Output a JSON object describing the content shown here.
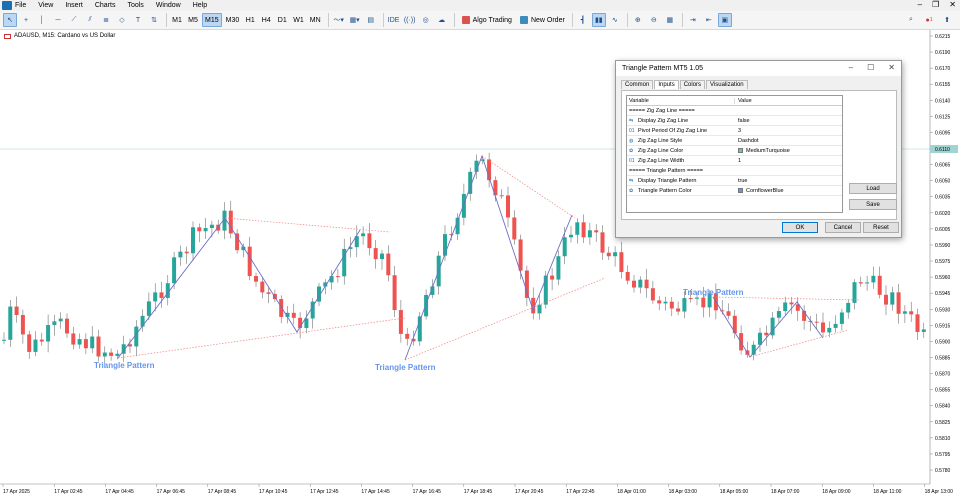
{
  "menu": {
    "items": [
      "File",
      "View",
      "Insert",
      "Charts",
      "Tools",
      "Window",
      "Help"
    ]
  },
  "toolbar": {
    "timeframes": [
      "M1",
      "M5",
      "M15",
      "M30",
      "H1",
      "H4",
      "D1",
      "W1",
      "MN"
    ],
    "active_timeframe": "M15",
    "ide_label": "IDE",
    "algo_label": "Algo Trading",
    "order_label": "New Order",
    "notif_count": "1"
  },
  "chart": {
    "symbol_line": "ADAUSD, M15:  Cardano vs US Dollar",
    "current_price": "0.6110",
    "price_labels": [
      "0.6215",
      "0.6190",
      "0.6170",
      "0.6155",
      "0.6140",
      "0.6125",
      "0.6095",
      "0.6080",
      "0.6065",
      "0.6050",
      "0.6035",
      "0.6020",
      "0.6005",
      "0.5990",
      "0.5975",
      "0.5960",
      "0.5945",
      "0.5930",
      "0.5915",
      "0.5900",
      "0.5885",
      "0.5870",
      "0.5855",
      "0.5840",
      "0.5825",
      "0.5810",
      "0.5795",
      "0.5780"
    ],
    "time_labels": [
      "17 Apr 2025",
      "17 Apr 02:45",
      "17 Apr 04:45",
      "17 Apr 06:45",
      "17 Apr 08:45",
      "17 Apr 10:45",
      "17 Apr 12:45",
      "17 Apr 14:45",
      "17 Apr 16:45",
      "17 Apr 18:45",
      "17 Apr 20:45",
      "17 Apr 22:45",
      "18 Apr 01:00",
      "18 Apr 03:00",
      "18 Apr 05:00",
      "18 Apr 07:00",
      "18 Apr 09:00",
      "18 Apr 11:00",
      "18 Apr 13:00"
    ],
    "pattern_labels": [
      "Triangle Pattern",
      "Triangle Pattern",
      "Triangle Pattern"
    ],
    "colors": {
      "bull": "#26a69a",
      "bear": "#ef5350",
      "zigzag": "#6b6fc4",
      "triangle": "#f08080",
      "pattern_text": "#6495ed",
      "price_line": "#9fd4d0"
    }
  },
  "dialog": {
    "title": "Triangle Pattern MT5 1.05",
    "tabs": [
      "Common",
      "Inputs",
      "Colors",
      "Visualization"
    ],
    "active_tab": "Inputs",
    "header": {
      "variable": "Variable",
      "value": "Value"
    },
    "rows": [
      {
        "icon": "",
        "name": "===== Zig Zag Line =====",
        "value": ""
      },
      {
        "icon": "toggle-icon",
        "name": "Display Zig Zag Line",
        "value": "false"
      },
      {
        "icon": "number-icon",
        "name": "Pivot Period Of Zig Zag Line",
        "value": "3"
      },
      {
        "icon": "style-icon",
        "name": "Zig Zag Line Style",
        "value": "Dashdot"
      },
      {
        "icon": "color-icon",
        "name": "Zig Zag Line Color",
        "value": "MediumTurquoise",
        "swatch": "#48d1cc"
      },
      {
        "icon": "number-icon",
        "name": "Zig Zag Line Width",
        "value": "1"
      },
      {
        "icon": "",
        "name": "===== Triangle Pattern =====",
        "value": ""
      },
      {
        "icon": "toggle-icon",
        "name": "Display Triangle Pattern",
        "value": "true"
      },
      {
        "icon": "color-icon",
        "name": "Triangle Pattern Color",
        "value": "CornflowerBlue",
        "swatch": "#6495ed"
      }
    ],
    "load_label": "Load",
    "save_label": "Save",
    "ok_label": "OK",
    "cancel_label": "Cancel",
    "reset_label": "Reset"
  }
}
